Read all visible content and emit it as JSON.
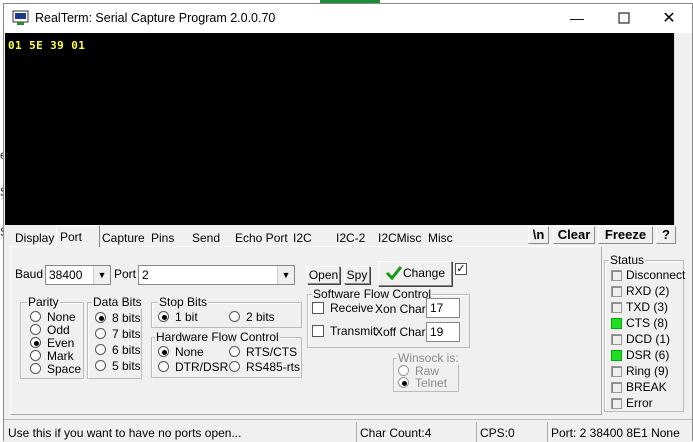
{
  "window": {
    "title": "RealTerm: Serial Capture Program 2.0.0.70"
  },
  "terminal": {
    "text": "01 5E 39 01"
  },
  "tabs": [
    "Display",
    "Port",
    "Capture",
    "Pins",
    "Send",
    "Echo Port",
    "I2C",
    "I2C-2",
    "I2CMisc",
    "Misc"
  ],
  "active_tab": "Port",
  "toolbar": {
    "newline": "\\n",
    "clear": "Clear",
    "freeze": "Freeze",
    "help": "?"
  },
  "port": {
    "baud_label": "Baud",
    "baud_value": "38400",
    "port_label": "Port",
    "port_value": "2",
    "open_button": "Open",
    "spy_button": "Spy",
    "change_button": "Change"
  },
  "parity": {
    "title": "Parity",
    "options": [
      "None",
      "Odd",
      "Even",
      "Mark",
      "Space"
    ],
    "selected": "Even"
  },
  "data_bits": {
    "title": "Data Bits",
    "options": [
      "8 bits",
      "7 bits",
      "6 bits",
      "5 bits"
    ],
    "selected": "8 bits"
  },
  "stop_bits": {
    "title": "Stop Bits",
    "options": [
      "1 bit",
      "2 bits"
    ],
    "selected": "1 bit"
  },
  "hw_flow": {
    "title": "Hardware Flow Control",
    "options": [
      "None",
      "RTS/CTS",
      "DTR/DSR",
      "RS485-rts"
    ],
    "selected": "None"
  },
  "sw_flow": {
    "title": "Software Flow Control",
    "receive_label": "Receive",
    "transmit_label": "Transmit",
    "xon_label": "Xon Char:",
    "xon_value": "17",
    "xoff_label": "Xoff Char:",
    "xoff_value": "19"
  },
  "winsock": {
    "title": "Winsock is:",
    "options": [
      "Raw",
      "Telnet"
    ],
    "selected": "Telnet"
  },
  "status": {
    "title": "Status",
    "items": [
      {
        "label": "Disconnect",
        "on": false
      },
      {
        "label": "RXD (2)",
        "on": false
      },
      {
        "label": "TXD (3)",
        "on": false
      },
      {
        "label": "CTS (8)",
        "on": true
      },
      {
        "label": "DCD (1)",
        "on": false
      },
      {
        "label": "DSR (6)",
        "on": true
      },
      {
        "label": "Ring (9)",
        "on": false
      },
      {
        "label": "BREAK",
        "on": false
      },
      {
        "label": "Error",
        "on": false
      }
    ],
    "led_on_color": "#22dd22"
  },
  "statusbar": {
    "hint": "Use this if you want to have no ports open...",
    "char_count": "Char Count:4",
    "cps": "CPS:0",
    "port_info": "Port: 2 38400 8E1 None"
  },
  "background": {
    "chars": [
      "e",
      "S",
      "S"
    ]
  }
}
